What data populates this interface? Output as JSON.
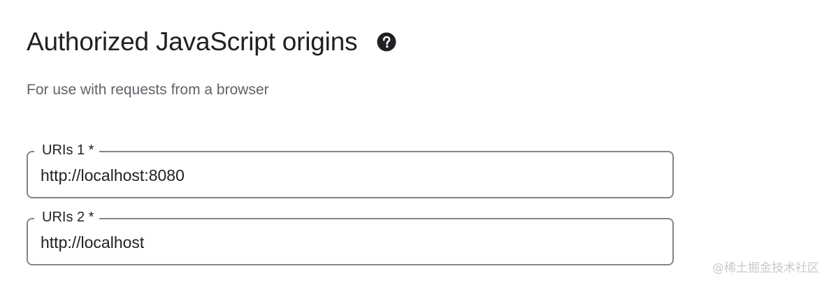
{
  "section": {
    "title": "Authorized JavaScript origins",
    "help_icon": "help-circle-icon",
    "subtitle": "For use with requests from a browser"
  },
  "uris": [
    {
      "label": "URIs 1 *",
      "value": "http://localhost:8080"
    },
    {
      "label": "URIs 2 *",
      "value": "http://localhost"
    }
  ],
  "watermark": "@稀土掘金技术社区",
  "colors": {
    "title": "#202124",
    "subtitle": "#5f6368",
    "field_border": "#80868b",
    "watermark": "#c9c9c9"
  }
}
